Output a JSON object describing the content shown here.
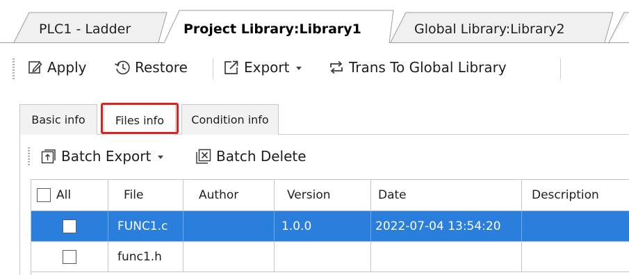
{
  "editor_tabs": [
    {
      "label": "PLC1 - Ladder",
      "active": false
    },
    {
      "label": "Project Library:Library1",
      "active": true
    },
    {
      "label": "Global Library:Library2",
      "active": false
    }
  ],
  "toolbar": {
    "apply": "Apply",
    "restore": "Restore",
    "export": "Export",
    "trans": "Trans To Global Library"
  },
  "sub_tabs": [
    "Basic info",
    "Files info",
    "Condition info"
  ],
  "active_sub_tab": "Files info",
  "highlight_color": "#e01f1f",
  "file_toolbar": {
    "batch_export": "Batch Export",
    "batch_delete": "Batch Delete"
  },
  "table": {
    "columns": [
      "All",
      "File",
      "Author",
      "Version",
      "Date",
      "Description"
    ],
    "rows": [
      {
        "checked": false,
        "file": "FUNC1.c",
        "author": "",
        "version": "1.0.0",
        "date": "2022-07-04 13:54:20",
        "description": "",
        "selected": true
      },
      {
        "checked": false,
        "file": "func1.h",
        "author": "",
        "version": "",
        "date": "",
        "description": "",
        "selected": false
      }
    ]
  },
  "colors": {
    "selection": "#2a7fdd",
    "accent_red": "#e01f1f"
  }
}
